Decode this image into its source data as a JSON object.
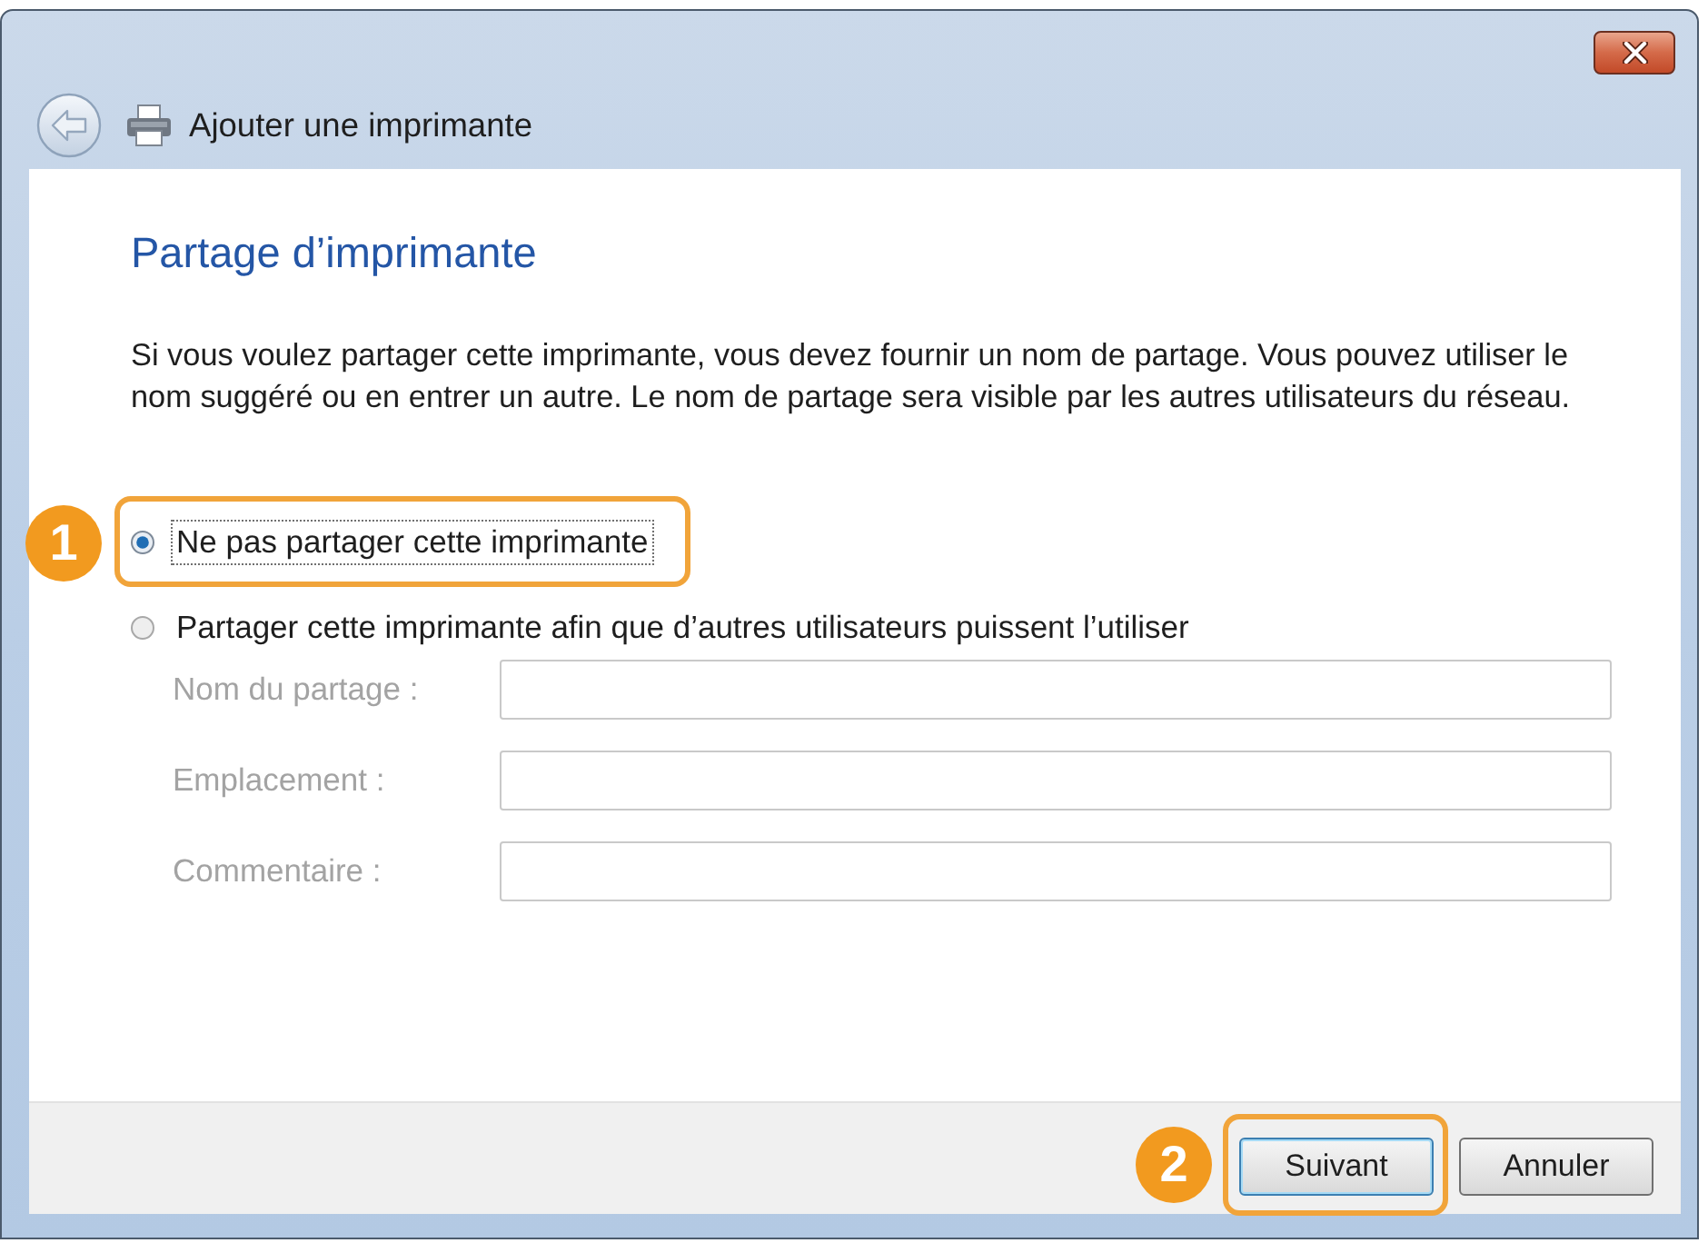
{
  "window": {
    "title": "Ajouter une imprimante"
  },
  "heading": "Partage d’imprimante",
  "description": "Si vous voulez partager cette imprimante, vous devez fournir un nom de partage. Vous pouvez utiliser le nom suggéré ou en entrer un autre. Le nom de partage sera visible par les autres utilisateurs du réseau.",
  "options": [
    {
      "label": "Ne pas partager cette imprimante",
      "selected": true,
      "focused": true,
      "callout": "1"
    },
    {
      "label": "Partager cette imprimante afin que d’autres utilisateurs puissent l’utiliser",
      "selected": false,
      "focused": false
    }
  ],
  "fields": [
    {
      "label": "Nom du partage :",
      "disabled": true
    },
    {
      "label": "Emplacement :",
      "disabled": true
    },
    {
      "label": "Commentaire :",
      "disabled": true
    }
  ],
  "buttons": [
    {
      "label": "Suivant",
      "default": true,
      "callout": "2"
    },
    {
      "label": "Annuler",
      "default": false
    }
  ]
}
